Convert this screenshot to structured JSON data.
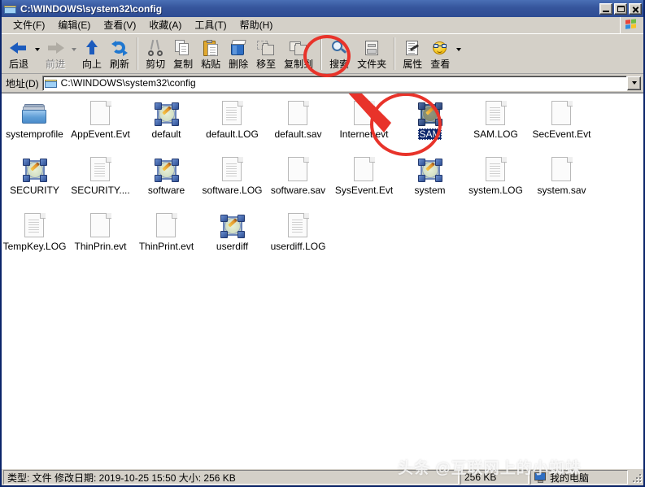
{
  "window": {
    "title": "C:\\WINDOWS\\system32\\config",
    "title_icon": "folder-icon",
    "minimize_label": "最小化",
    "maximize_label": "最大化",
    "close_label": "关闭"
  },
  "menu": {
    "items": [
      {
        "label": "文件(F)",
        "name": "menu-file"
      },
      {
        "label": "编辑(E)",
        "name": "menu-edit"
      },
      {
        "label": "查看(V)",
        "name": "menu-view"
      },
      {
        "label": "收藏(A)",
        "name": "menu-favorites"
      },
      {
        "label": "工具(T)",
        "name": "menu-tools"
      },
      {
        "label": "帮助(H)",
        "name": "menu-help"
      }
    ],
    "brand_icon": "windows-flag-icon"
  },
  "toolbar": {
    "back_label": "后退",
    "forward_label": "前进",
    "up_label": "向上",
    "refresh_label": "刷新",
    "cut_label": "剪切",
    "copy_label": "复制",
    "paste_label": "粘贴",
    "delete_label": "删除",
    "moveto_label": "移至",
    "copyto_label": "复制到",
    "search_label": "搜索",
    "folders_label": "文件夹",
    "properties_label": "属性",
    "views_label": "查看"
  },
  "address": {
    "label": "地址(D)",
    "value": "C:\\WINDOWS\\system32\\config",
    "placeholder": "C:\\WINDOWS\\system32\\config",
    "dropdown_icon": "chevron-down-icon"
  },
  "files": [
    {
      "name": "systemprofile",
      "icon": "folder",
      "selected": false
    },
    {
      "name": "AppEvent.Evt",
      "icon": "doc-blank",
      "selected": false
    },
    {
      "name": "default",
      "icon": "registry",
      "selected": false
    },
    {
      "name": "default.LOG",
      "icon": "doc-lined",
      "selected": false
    },
    {
      "name": "default.sav",
      "icon": "doc-blank",
      "selected": false
    },
    {
      "name": "Internet.evt",
      "icon": "doc-blank",
      "selected": false
    },
    {
      "name": "SAM",
      "icon": "registry",
      "selected": true
    },
    {
      "name": "SAM.LOG",
      "icon": "doc-lined",
      "selected": false
    },
    {
      "name": "SecEvent.Evt",
      "icon": "doc-blank",
      "selected": false
    },
    {
      "name": "SECURITY",
      "icon": "registry",
      "selected": false
    },
    {
      "name": "SECURITY....",
      "icon": "doc-lined",
      "selected": false
    },
    {
      "name": "software",
      "icon": "registry",
      "selected": false
    },
    {
      "name": "software.LOG",
      "icon": "doc-lined",
      "selected": false
    },
    {
      "name": "software.sav",
      "icon": "doc-blank",
      "selected": false
    },
    {
      "name": "SysEvent.Evt",
      "icon": "doc-blank",
      "selected": false
    },
    {
      "name": "system",
      "icon": "registry",
      "selected": false
    },
    {
      "name": "system.LOG",
      "icon": "doc-lined",
      "selected": false
    },
    {
      "name": "system.sav",
      "icon": "doc-blank",
      "selected": false
    },
    {
      "name": "TempKey.LOG",
      "icon": "doc-lined",
      "selected": false
    },
    {
      "name": "ThinPrin.evt",
      "icon": "doc-blank",
      "selected": false
    },
    {
      "name": "ThinPrint.evt",
      "icon": "doc-blank",
      "selected": false
    },
    {
      "name": "userdiff",
      "icon": "registry",
      "selected": false
    },
    {
      "name": "userdiff.LOG",
      "icon": "doc-lined",
      "selected": false
    }
  ],
  "status": {
    "details": "类型: 文件 修改日期: 2019-10-25 15:50 大小: 256 KB",
    "size": "256 KB",
    "location": "我的电脑",
    "location_icon": "my-computer-icon"
  },
  "annotations": {
    "watermark": "头条 @互联网上的小蜘蛛",
    "circle_delete": "red-ellipse-around-delete-button",
    "circle_sam": "red-ellipse-around-sam-file",
    "arrow": "red-arrow-from-sam-to-delete"
  },
  "colors": {
    "titlebar": "#36559c",
    "chrome": "#d4d0c8",
    "selection": "#0a246a",
    "annotation": "#e8332a"
  }
}
